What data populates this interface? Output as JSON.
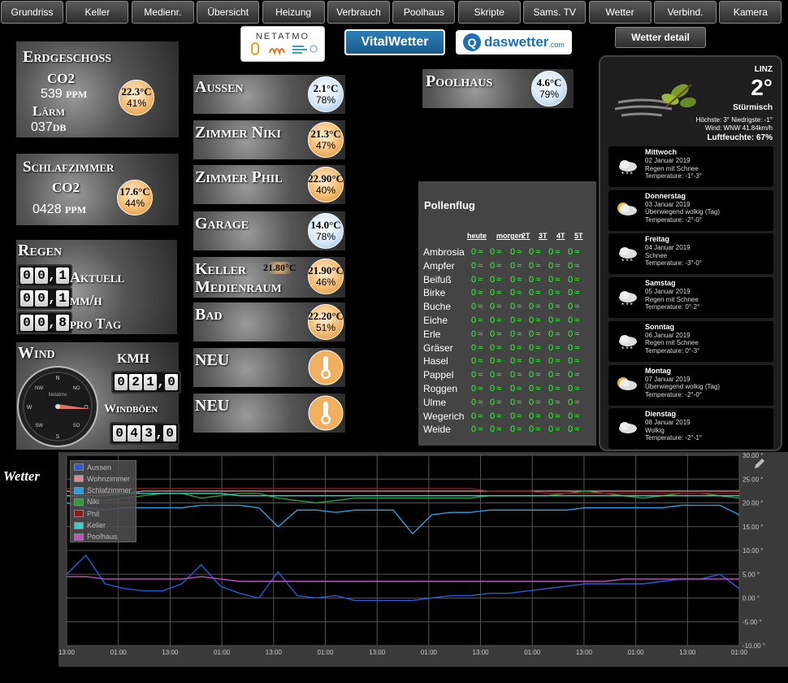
{
  "nav": [
    "Grundriss",
    "Keller",
    "Medienr.",
    "Übersicht",
    "Heizung",
    "Verbrauch",
    "Poolhaus",
    "Skripte",
    "Sams. TV",
    "Wetter",
    "Verbind.",
    "Kamera"
  ],
  "logos": {
    "netatmo": "NETATMO",
    "vitalwetter": "VitalWetter",
    "daswetter": "daswetter",
    "daswetter_suffix": ".com"
  },
  "wetter_detail_button": "Wetter detail",
  "erdgeschoss": {
    "title": "Erdgeschoss",
    "co2_label": "CO2",
    "co2_value": "539",
    "co2_unit": "PPM",
    "noise_label": "Lärm",
    "noise_value": "037",
    "noise_unit": "DB",
    "temp": "22.3°C",
    "hum": "41%"
  },
  "schlafzimmer": {
    "title": "Schlafzimmer",
    "co2_label": "CO2",
    "co2_value": "0428",
    "co2_unit": "PPM",
    "temp": "17.6°C",
    "hum": "44%"
  },
  "regen": {
    "title": "Regen",
    "row1": "Aktuell",
    "row2": "mm/h",
    "row3": "pro Tag",
    "d1": [
      "0",
      "0",
      "1"
    ],
    "d2": [
      "0",
      "0",
      "1"
    ],
    "d3": [
      "0",
      "0",
      "8"
    ]
  },
  "wind": {
    "title": "Wind",
    "unit": "KMH",
    "gust_label": "Windböen",
    "speed": [
      "0",
      "2",
      "1",
      "0"
    ],
    "gust": [
      "0",
      "4",
      "3",
      "0"
    ],
    "compass": {
      "n": "N",
      "nw": "NW",
      "no": "NO",
      "w": "W",
      "o": "O",
      "sw": "SW",
      "so": "SO",
      "s": "S",
      "brand": "Netatmo"
    }
  },
  "rooms": [
    {
      "name": "Aussen",
      "temp": "2.1°C",
      "hum": "78%",
      "style": "cold"
    },
    {
      "name": "Zimmer Niki",
      "temp": "21.3°C",
      "hum": "47%",
      "style": "warm"
    },
    {
      "name": "Zimmer Phil",
      "temp": "22.90°C",
      "hum": "40%",
      "style": "warm"
    },
    {
      "name": "Garage",
      "temp": "14.0°C",
      "hum": "78%",
      "style": "cold"
    },
    {
      "name": "Keller",
      "name2": "Medienraum",
      "extra_temp": "21.80°C",
      "temp": "21.90°C",
      "hum": "46%",
      "style": "warm"
    },
    {
      "name": "Bad",
      "temp": "22.20°C",
      "hum": "51%",
      "style": "warm"
    },
    {
      "name": "NEU"
    },
    {
      "name": "NEU"
    }
  ],
  "poolhaus": {
    "title": "Poolhaus",
    "temp": "4.6°C",
    "hum": "79%"
  },
  "pollen": {
    "title": "Pollenflug",
    "headers": [
      "heute",
      "morgen",
      "2T",
      "3T",
      "4T",
      "5T"
    ],
    "value": "0",
    "symbol": "≈",
    "plants": [
      "Ambrosia",
      "Ampfer",
      "Beifuß",
      "Birke",
      "Buche",
      "Eiche",
      "Erle",
      "Gräser",
      "Hasel",
      "Pappel",
      "Roggen",
      "Ulme",
      "Wegerich",
      "Weide"
    ]
  },
  "weather_now": {
    "city": "LINZ",
    "temp": "2°",
    "cond": "Stürmisch",
    "line1": "Höchste: 3° Niedrigste: -1°",
    "line2": "Wind: WNW 41.84km/h",
    "line3": "Luftfeuchte: 67%"
  },
  "forecast": [
    {
      "day": "Mittwoch",
      "date": "02 Januar 2019",
      "cond": "Regen mit Schnee",
      "temp": "Temperature: -1°-3°",
      "icon": "snow-cloud-icon"
    },
    {
      "day": "Donnerstag",
      "date": "03 Januar 2019",
      "cond": "Überwiegend wolkig (Tag)",
      "temp": "Temperature: -2°-0°",
      "icon": "partly-cloudy-icon"
    },
    {
      "day": "Freitag",
      "date": "04 Januar 2019",
      "cond": "Schnee",
      "temp": "Temperature: -3°-0°",
      "icon": "snow-cloud-icon"
    },
    {
      "day": "Samstag",
      "date": "05 Januar 2019",
      "cond": "Regen mit Schnee",
      "temp": "Temperature: 0°-2°",
      "icon": "snow-cloud-icon"
    },
    {
      "day": "Sonntag",
      "date": "06 Januar 2019",
      "cond": "Regen mit Schnee",
      "temp": "Temperature: 0°-3°",
      "icon": "snow-cloud-icon"
    },
    {
      "day": "Montag",
      "date": "07 Januar 2019",
      "cond": "Überwiegend wolkig (Tag)",
      "temp": "Temperature: -2°-0°",
      "icon": "partly-cloudy-icon"
    },
    {
      "day": "Dienstag",
      "date": "08 Januar 2019",
      "cond": "Wolkig",
      "temp": "Temperature: -2°-1°",
      "icon": "cloud-icon"
    }
  ],
  "wetter_label": "Wetter",
  "chart_data": {
    "type": "line",
    "y_ticks": [
      "30.00 °",
      "25.00 °",
      "20.00 °",
      "15.00 °",
      "10.00 °",
      "5.00 °",
      "0.00 °",
      "-5.00 °",
      "-10.00 °"
    ],
    "x_ticks": [
      "13:00",
      "01:00",
      "13:00",
      "01:00",
      "13:00",
      "01:00",
      "13:00",
      "01:00",
      "13:00",
      "01:00",
      "13:00",
      "01:00",
      "13:00",
      "01:00"
    ],
    "ylim": [
      -10,
      30
    ],
    "series": [
      {
        "name": "Aussen",
        "color": "#2a5bd7",
        "values": [
          5,
          9,
          3,
          2,
          1.5,
          1.5,
          3,
          7,
          2.5,
          1,
          0,
          5.5,
          0.5,
          0,
          0.5,
          -0.5,
          -0.5,
          -0.5,
          -0.5,
          0,
          0.5,
          0.5,
          1,
          1,
          1.5,
          2,
          2.5,
          3,
          3,
          3,
          3,
          3.5,
          4,
          4,
          5,
          2
        ]
      },
      {
        "name": "Wohnzimmer",
        "color": "#d98a9a",
        "values": [
          22.5,
          22,
          22,
          22,
          22.5,
          22.5,
          22.5,
          22.5,
          22.5,
          22.5,
          22.5,
          22.5,
          22.5,
          22.5,
          22.5,
          22.5,
          22.5,
          22.5,
          22.5,
          22.5,
          22.5,
          22.5,
          22.5,
          22.5,
          22.5,
          22.5,
          22.5,
          22.5,
          22.5,
          22.5,
          22.5,
          22.5,
          22.5,
          22.5,
          22.5,
          22.5
        ]
      },
      {
        "name": "Schlafzimmer",
        "color": "#2aa0e0",
        "values": [
          20,
          19,
          18.5,
          19,
          19,
          19,
          19,
          19.5,
          19.5,
          19.5,
          19,
          15,
          18.5,
          18.5,
          18,
          18.5,
          18.5,
          18.5,
          13.5,
          17.5,
          18,
          18,
          18.5,
          18.5,
          18.5,
          18.5,
          18.5,
          19,
          19,
          19,
          19,
          19,
          19.5,
          19.5,
          19.5,
          17.5
        ]
      },
      {
        "name": "Niki",
        "color": "#2e9a3a",
        "values": [
          21.5,
          21,
          20.5,
          21,
          21.5,
          22,
          22,
          21,
          21.5,
          22,
          22,
          21,
          20.5,
          20,
          20.5,
          21,
          21,
          21,
          21,
          21,
          21,
          21,
          21.5,
          21.5,
          21.5,
          21.5,
          22,
          22.5,
          22,
          21.5,
          21,
          21.5,
          22,
          22,
          21.5,
          21
        ]
      },
      {
        "name": "Phil",
        "color": "#8a1c1c",
        "values": [
          23,
          23,
          23,
          23,
          23,
          23,
          23,
          23,
          23,
          23,
          23,
          23,
          23,
          23,
          23,
          23,
          23,
          23,
          23,
          23,
          23,
          23,
          22.5,
          22.5,
          22.5,
          22,
          22,
          22,
          22,
          22,
          22,
          22,
          22,
          22,
          22,
          22
        ]
      },
      {
        "name": "Keller",
        "color": "#2fd6c8",
        "values": [
          21.5,
          21.5,
          21.5,
          22,
          22,
          22,
          22,
          22,
          22,
          21.5,
          21.5,
          21.5,
          21.5,
          21.5,
          21.5,
          21.5,
          21.5,
          21.5,
          21.5,
          21.5,
          21.5,
          21.5,
          21.5,
          21.5,
          21.5,
          21.5,
          21.5,
          21.5,
          21.5,
          21.5,
          21.5,
          21.5,
          21.5,
          21.5,
          21.5,
          21.5
        ]
      },
      {
        "name": "Poolhaus",
        "color": "#c24fc2",
        "values": [
          4.5,
          4.5,
          4,
          4,
          4,
          4,
          4,
          4.5,
          4,
          3.5,
          3.5,
          3.5,
          3.5,
          3.5,
          3.5,
          3.5,
          3.5,
          3.5,
          3.5,
          3.5,
          3.5,
          3.5,
          3.5,
          3.5,
          3.5,
          3.5,
          3.5,
          3.5,
          3.5,
          4,
          4,
          4,
          4,
          4,
          4,
          4
        ]
      }
    ]
  }
}
